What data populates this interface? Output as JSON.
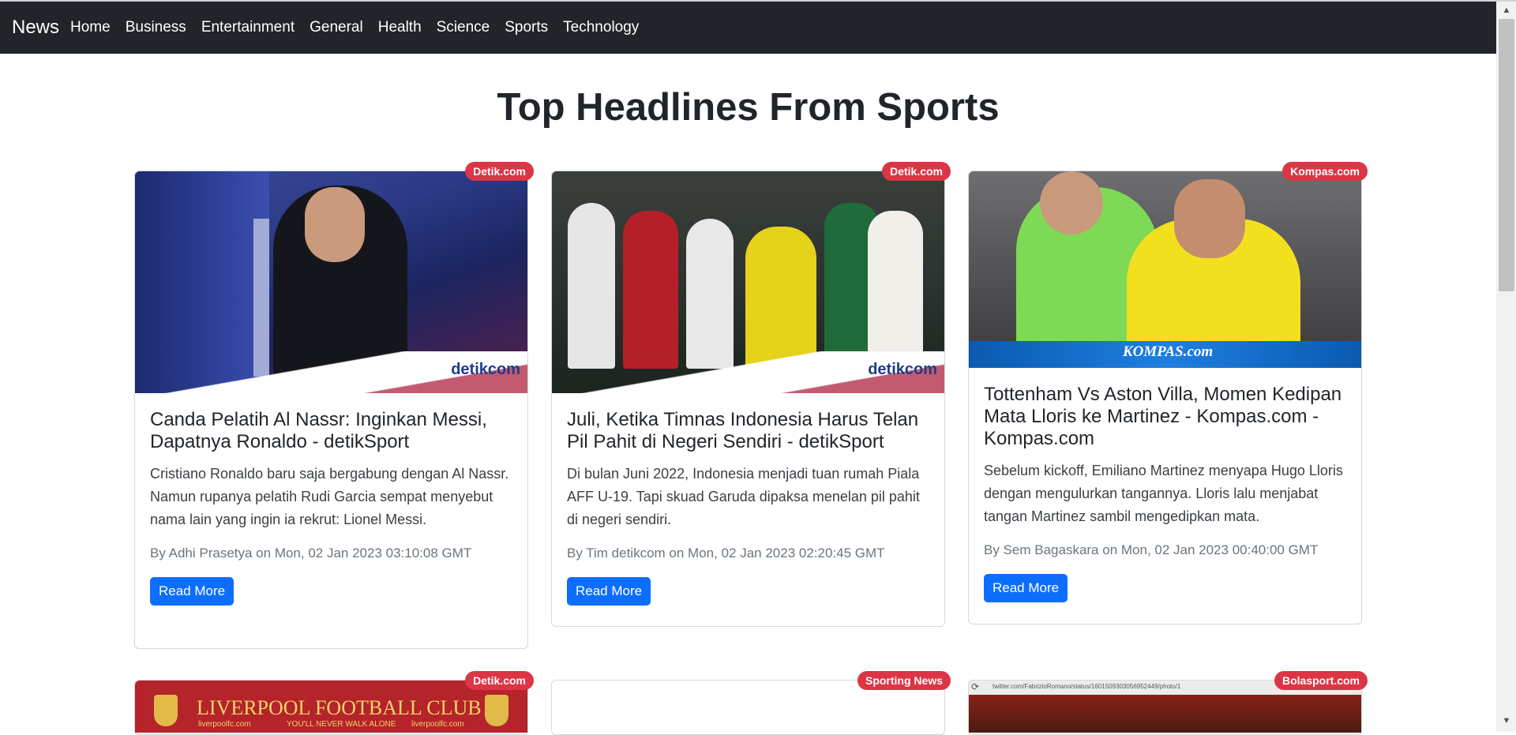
{
  "nav": {
    "brand": "News",
    "items": [
      "Home",
      "Business",
      "Entertainment",
      "General",
      "Health",
      "Science",
      "Sports",
      "Technology"
    ]
  },
  "page": {
    "title": "Top Headlines From Sports"
  },
  "cards": [
    {
      "source": "Detik.com",
      "title": "Canda Pelatih Al Nassr: Inginkan Messi, Dapatnya Ronaldo - detikSport",
      "description": "Cristiano Ronaldo baru saja bergabung dengan Al Nassr. Namun rupanya pelatih Rudi Garcia sempat menyebut nama lain yang ingin ia rekrut: Lionel Messi.",
      "meta": "By Adhi Prasetya on Mon, 02 Jan 2023 03:10:08 GMT",
      "button": "Read More",
      "watermark": "detikcom"
    },
    {
      "source": "Detik.com",
      "title": "Juli, Ketika Timnas Indonesia Harus Telan Pil Pahit di Negeri Sendiri - detikSport",
      "description": "Di bulan Juni 2022, Indonesia menjadi tuan rumah Piala AFF U-19. Tapi skuad Garuda dipaksa menelan pil pahit di negeri sendiri.",
      "meta": "By Tim detikcom on Mon, 02 Jan 2023 02:20:45 GMT",
      "button": "Read More",
      "watermark": "detikcom"
    },
    {
      "source": "Kompas.com",
      "title": "Tottenham Vs Aston Villa, Momen Kedipan Mata Lloris ke Martinez - Kompas.com - Kompas.com",
      "description": "Sebelum kickoff, Emiliano Martinez menyapa Hugo Lloris dengan mengulurkan tangannya. Lloris lalu menjabat tangan Martinez sambil mengedipkan mata.",
      "meta": "By Sem Bagaskara on Mon, 02 Jan 2023 00:40:00 GMT",
      "button": "Read More",
      "watermark": "KOMPAS.com"
    },
    {
      "source": "Detik.com",
      "banner": "LIVERPOOL FOOTBALL CLUB",
      "sub_left": "liverpoolfc.com",
      "sub_mid": "YOU'LL NEVER WALK ALONE",
      "sub_right": "liverpoolfc.com"
    },
    {
      "source": "Sporting News"
    },
    {
      "source": "Bolasport.com",
      "url": "twitter.com/FabrizioRomano/status/1601509303056952449/photo/1"
    }
  ]
}
